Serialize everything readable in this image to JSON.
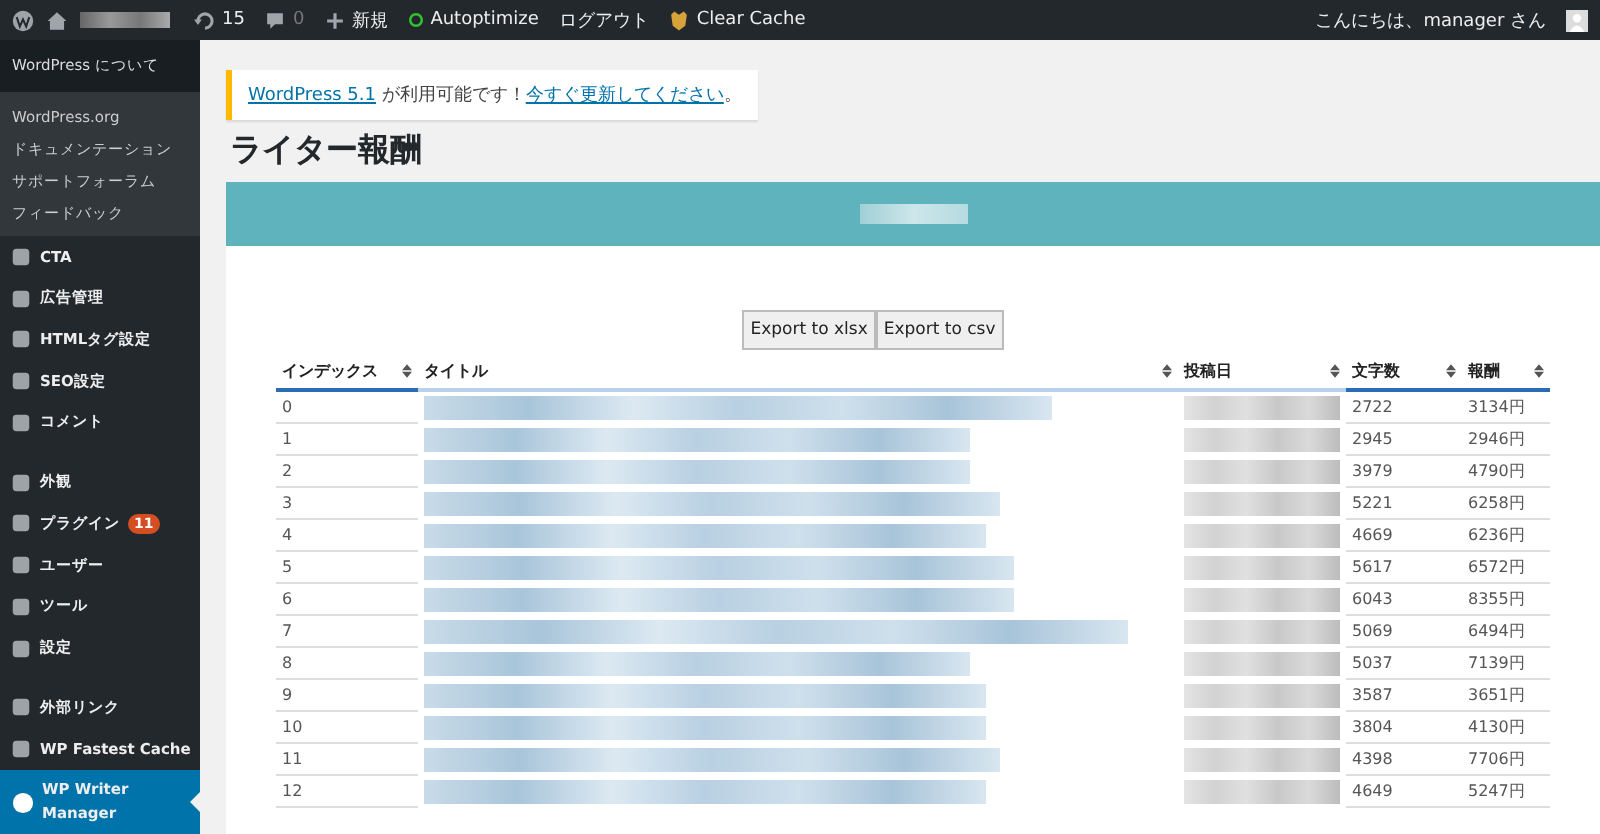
{
  "admin_bar": {
    "updates": "15",
    "comments": "0",
    "new": "新規",
    "autoptimize": "Autoptimize",
    "logout": "ログアウト",
    "clear_cache": "Clear Cache",
    "greeting": "こんにちは、manager さん"
  },
  "sidebar": {
    "header": "WordPress について",
    "submenu": [
      "WordPress.org",
      "ドキュメンテーション",
      "サポートフォーラム",
      "フィードバック"
    ],
    "items": [
      {
        "label": "CTA",
        "selected": false,
        "separator_before": false
      },
      {
        "label": "広告管理",
        "selected": false,
        "separator_before": false
      },
      {
        "label": "HTMLタグ設定",
        "selected": false,
        "separator_before": false
      },
      {
        "label": "SEO設定",
        "selected": false,
        "separator_before": false
      },
      {
        "label": "コメント",
        "selected": false,
        "separator_before": false
      },
      {
        "label": "外観",
        "selected": false,
        "separator_before": true
      },
      {
        "label": "プラグイン",
        "selected": false,
        "separator_before": false,
        "badge": "11"
      },
      {
        "label": "ユーザー",
        "selected": false,
        "separator_before": false
      },
      {
        "label": "ツール",
        "selected": false,
        "separator_before": false
      },
      {
        "label": "設定",
        "selected": false,
        "separator_before": false
      },
      {
        "label": "外部リンク",
        "selected": false,
        "separator_before": true
      },
      {
        "label": "WP Fastest Cache",
        "selected": false,
        "separator_before": false
      },
      {
        "label": "WP Writer Manager",
        "selected": true,
        "separator_before": false
      }
    ]
  },
  "notice": {
    "link": "WordPress 5.1",
    "text": "が利用可能です！",
    "action_link": "今すぐ更新してください",
    "end": "。"
  },
  "page_title": "ライター報酬",
  "buttons": [
    "Export to xlsx",
    "Export to csv"
  ],
  "table": {
    "columns": [
      "インデックス",
      "タイトル",
      "投稿日",
      "文字数",
      "報酬"
    ],
    "rows": [
      {
        "index": "0",
        "characters": "2722",
        "reward": "3134円"
      },
      {
        "index": "1",
        "characters": "2945",
        "reward": "2946円"
      },
      {
        "index": "2",
        "characters": "3979",
        "reward": "4790円"
      },
      {
        "index": "3",
        "characters": "5221",
        "reward": "6258円"
      },
      {
        "index": "4",
        "characters": "4669",
        "reward": "6236円"
      },
      {
        "index": "5",
        "characters": "5617",
        "reward": "6572円"
      },
      {
        "index": "6",
        "characters": "6043",
        "reward": "8355円"
      },
      {
        "index": "7",
        "characters": "5069",
        "reward": "6494円"
      },
      {
        "index": "8",
        "characters": "5037",
        "reward": "7139円"
      },
      {
        "index": "9",
        "characters": "3587",
        "reward": "3651円"
      },
      {
        "index": "10",
        "characters": "3804",
        "reward": "4130円"
      },
      {
        "index": "11",
        "characters": "4398",
        "reward": "7706円"
      },
      {
        "index": "12",
        "characters": "4649",
        "reward": "5247円"
      }
    ]
  }
}
